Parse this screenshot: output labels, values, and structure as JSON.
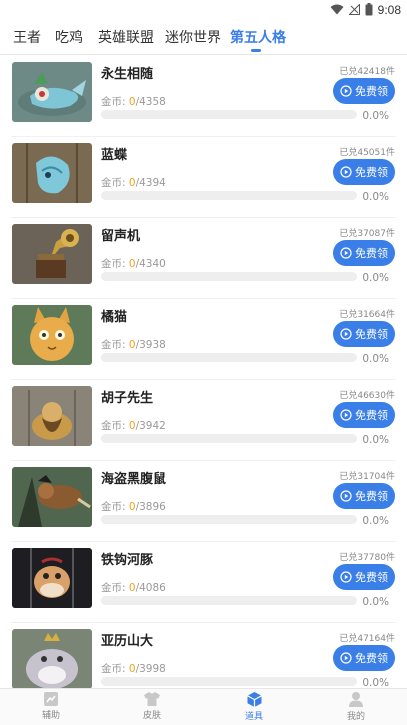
{
  "status_bar": {
    "time": "9:08",
    "icons": [
      "wifi-icon",
      "signal-icon",
      "battery-icon"
    ]
  },
  "tabs": [
    {
      "label": "王者",
      "active": false
    },
    {
      "label": "吃鸡",
      "active": false
    },
    {
      "label": "英雄联盟",
      "active": false
    },
    {
      "label": "迷你世界",
      "active": false
    },
    {
      "label": "第五人格",
      "active": true
    }
  ],
  "items": [
    {
      "name": "永生相随",
      "redeemed": "已兑42418件",
      "coins_label": "金币:",
      "coins_current": "0",
      "coins_total": "/4358",
      "button": "免费领",
      "percent_text": "0.0%",
      "progress": 0
    },
    {
      "name": "蓝蝶",
      "redeemed": "已兑45051件",
      "coins_label": "金币:",
      "coins_current": "0",
      "coins_total": "/4394",
      "button": "免费领",
      "percent_text": "0.0%",
      "progress": 0
    },
    {
      "name": "留声机",
      "redeemed": "已兑37087件",
      "coins_label": "金币:",
      "coins_current": "0",
      "coins_total": "/4340",
      "button": "免费领",
      "percent_text": "0.0%",
      "progress": 0
    },
    {
      "name": "橘猫",
      "redeemed": "已兑31664件",
      "coins_label": "金币:",
      "coins_current": "0",
      "coins_total": "/3938",
      "button": "免费领",
      "percent_text": "0.0%",
      "progress": 0
    },
    {
      "name": "胡子先生",
      "redeemed": "已兑46630件",
      "coins_label": "金币:",
      "coins_current": "0",
      "coins_total": "/3942",
      "button": "免费领",
      "percent_text": "0.0%",
      "progress": 0
    },
    {
      "name": "海盗黑腹鼠",
      "redeemed": "已兑31704件",
      "coins_label": "金币:",
      "coins_current": "0",
      "coins_total": "/3896",
      "button": "免费领",
      "percent_text": "0.0%",
      "progress": 0
    },
    {
      "name": "铁钩河豚",
      "redeemed": "已兑37780件",
      "coins_label": "金币:",
      "coins_current": "0",
      "coins_total": "/4086",
      "button": "免费领",
      "percent_text": "0.0%",
      "progress": 0
    },
    {
      "name": "亚历山大",
      "redeemed": "已兑47164件",
      "coins_label": "金币:",
      "coins_current": "0",
      "coins_total": "/3998",
      "button": "免费领",
      "percent_text": "0.0%",
      "progress": 0
    }
  ],
  "bottom_nav": [
    {
      "label": "辅助",
      "icon": "assist-icon",
      "active": false
    },
    {
      "label": "皮肤",
      "icon": "shirt-icon",
      "active": false
    },
    {
      "label": "道具",
      "icon": "cube-icon",
      "active": true
    },
    {
      "label": "我的",
      "icon": "user-icon",
      "active": false
    }
  ],
  "colors": {
    "accent": "#3a7ee8",
    "coin": "#f0a020"
  }
}
